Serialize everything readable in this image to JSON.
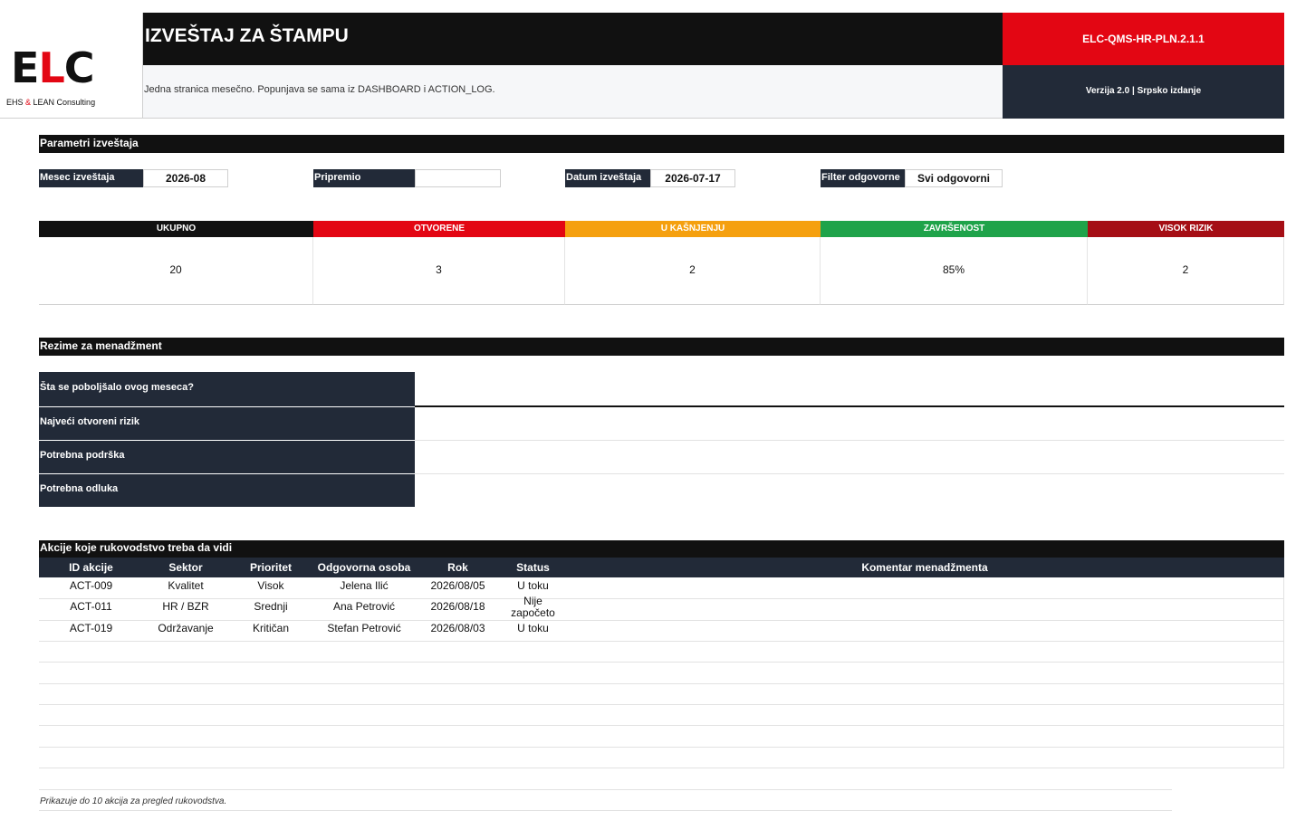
{
  "header": {
    "logo_letters": [
      "E",
      "L",
      "C"
    ],
    "logo_sub_a": "EHS ",
    "logo_sub_amp": "&",
    "logo_sub_b": " LEAN Consulting",
    "title": "IZVEŠTAJ ZA ŠTAMPU",
    "doc_code": "ELC-QMS-HR-PLN.2.1.1",
    "subtitle": "Jedna stranica mesečno. Popunjava se sama iz DASHBOARD i ACTION_LOG.",
    "version": "Verzija 2.0 | Srpsko izdanje"
  },
  "params": {
    "section_title": "Parametri izveštaja",
    "month_label": "Mesec izveštaja",
    "month_value": "2026-08",
    "prepared_label": "Pripremio",
    "prepared_value": "",
    "date_label": "Datum izveštaja",
    "date_value": "2026-07-17",
    "filter_label": "Filter odgovorne",
    "filter_value": "Svi odgovorni"
  },
  "kpis": [
    {
      "label": "UKUPNO",
      "value": "20",
      "color": "#111111"
    },
    {
      "label": "OTVORENE",
      "value": "3",
      "color": "#e30613"
    },
    {
      "label": "U KAŠNJENJU",
      "value": "2",
      "color": "#f5a00f"
    },
    {
      "label": "ZAVRŠENOST",
      "value": "85%",
      "color": "#1fa34a"
    },
    {
      "label": "VISOK RIZIK",
      "value": "2",
      "color": "#a50e15"
    }
  ],
  "summary": {
    "section_title": "Rezime za menadžment",
    "items": [
      {
        "label": "Šta se poboljšalo ovog meseca?",
        "value": ""
      },
      {
        "label": "Najveći otvoreni rizik",
        "value": ""
      },
      {
        "label": "Potrebna podrška",
        "value": ""
      },
      {
        "label": "Potrebna odluka",
        "value": ""
      }
    ]
  },
  "actions": {
    "section_title": "Akcije koje rukovodstvo treba da vidi",
    "columns": [
      "ID akcije",
      "Sektor",
      "Prioritet",
      "Odgovorna osoba",
      "Rok",
      "Status",
      "Komentar menadžmenta"
    ],
    "rows": [
      [
        "ACT-009",
        "Kvalitet",
        "Visok",
        "Jelena Ilić",
        "2026/08/05",
        "U toku",
        ""
      ],
      [
        "ACT-011",
        "HR / BZR",
        "Srednji",
        "Ana Petrović",
        "2026/08/18",
        "Nije započeto",
        ""
      ],
      [
        "ACT-019",
        "Održavanje",
        "Kritičan",
        "Stefan Petrović",
        "2026/08/03",
        "U toku",
        ""
      ]
    ],
    "note": "Prikazuje do 10 akcija za pregled rukovodstva."
  }
}
